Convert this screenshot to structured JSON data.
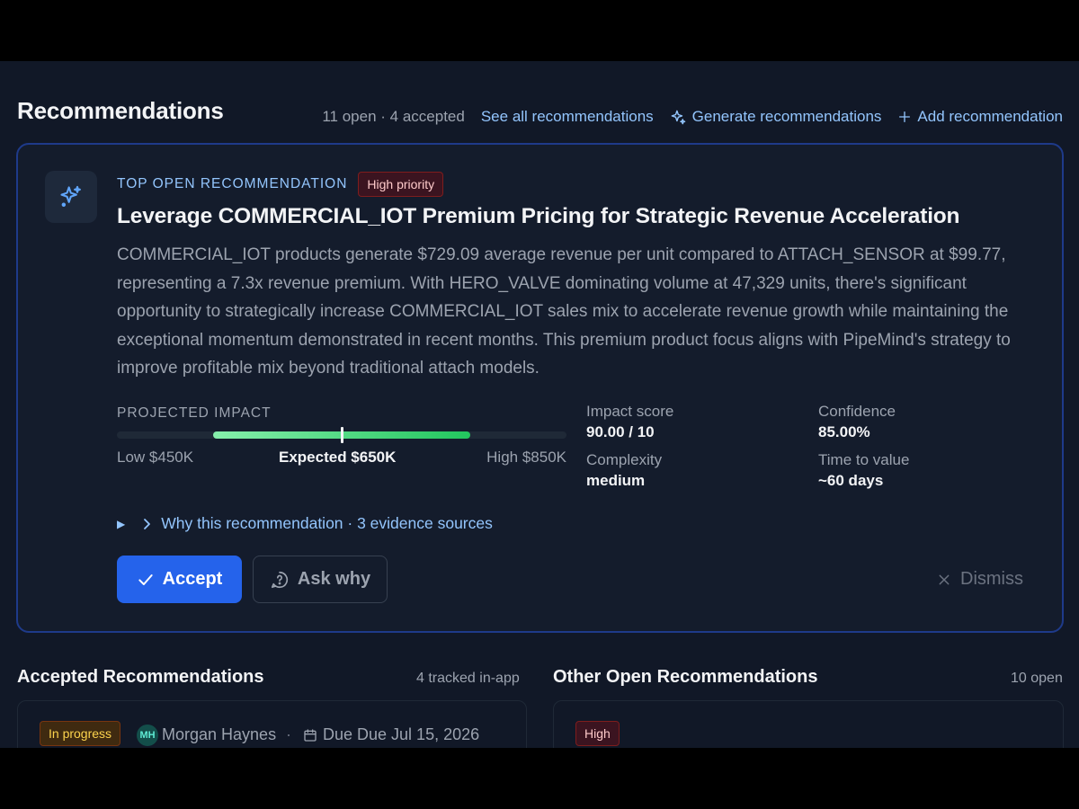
{
  "header": {
    "title": "Recommendations",
    "counts": "11 open · 4 accepted",
    "see_all": "See all recommendations",
    "generate": "Generate recommendations",
    "add": "Add recommendation"
  },
  "top": {
    "eyebrow": "TOP OPEN RECOMMENDATION",
    "priority": "High priority",
    "title": "Leverage COMMERCIAL_IOT Premium Pricing for Strategic Revenue Acceleration",
    "description": "COMMERCIAL_IOT products generate $729.09 average revenue per unit compared to ATTACH_SENSOR at $99.77, representing a 7.3x revenue premium. With HERO_VALVE dominating volume at 47,329 units, there's significant opportunity to strategically increase COMMERCIAL_IOT sales mix to accelerate revenue growth while maintaining the exceptional momentum demonstrated in recent months. This premium product focus aligns with PipeMind's strategy to improve profitable mix beyond traditional attach models.",
    "impact": {
      "label": "PROJECTED IMPACT",
      "low_label": "Low $450K",
      "expected_label": "Expected $650K",
      "high_label": "High $850K",
      "low": 450,
      "expected": 650,
      "high": 850
    },
    "metrics": {
      "impact_score_label": "Impact score",
      "impact_score_value": "90.00 / 10",
      "confidence_label": "Confidence",
      "confidence_value": "85.00%",
      "complexity_label": "Complexity",
      "complexity_value": "medium",
      "ttv_label": "Time to value",
      "ttv_value": "~60 days"
    },
    "why": "Why this recommendation · 3 evidence sources",
    "accept": "Accept",
    "ask_why": "Ask why",
    "dismiss": "Dismiss"
  },
  "accepted": {
    "title": "Accepted Recommendations",
    "meta": "4 tracked in-app",
    "first": {
      "status": "In progress",
      "avatar": "MH",
      "owner": "Morgan Haynes",
      "separator": "·",
      "due": "Due Due Jul 15, 2026"
    }
  },
  "other": {
    "title": "Other Open Recommendations",
    "meta": "10 open",
    "first": {
      "priority": "High"
    }
  },
  "colors": {
    "accent": "#2563eb",
    "link": "#93c5fd",
    "bar_start": "#86efac",
    "bar_end": "#22c55e"
  }
}
